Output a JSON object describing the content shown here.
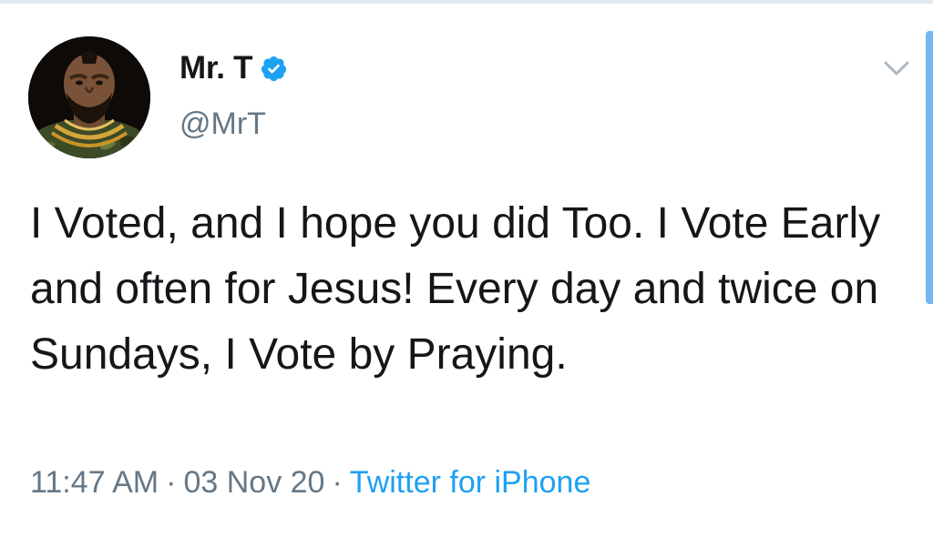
{
  "tweet": {
    "author": {
      "display_name": "Mr. T",
      "username": "@MrT",
      "verified": true,
      "avatar_icon": "profile-photo-icon"
    },
    "text": "I Voted, and I hope you did Too. I Vote Early and often for Jesus! Every day and twice on Sundays, I Vote by Praying.",
    "time": "11:47 AM",
    "separator": "·",
    "date": "03 Nov 20",
    "source": "Twitter for iPhone"
  },
  "icons": {
    "verified": "verified-badge-icon",
    "menu": "chevron-down-icon"
  },
  "colors": {
    "text_primary": "#14171a",
    "text_secondary": "#657786",
    "link": "#1da1f2",
    "verified": "#1da1f2",
    "divider": "#e1e8ed"
  }
}
